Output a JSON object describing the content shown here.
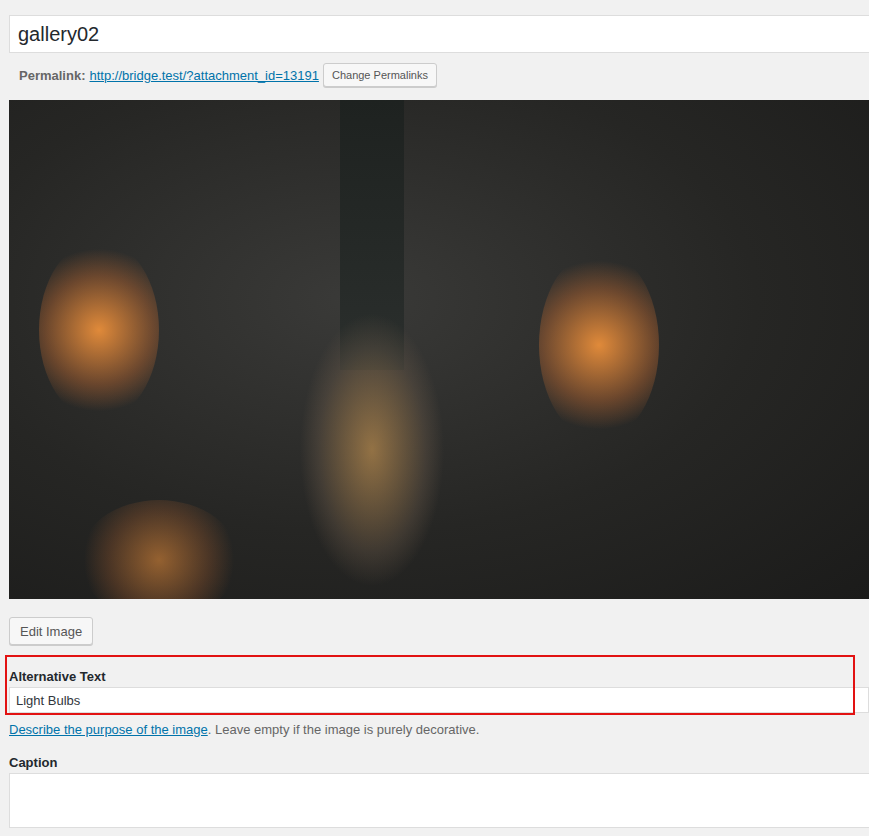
{
  "title_field": {
    "value": "gallery02"
  },
  "permalink": {
    "label": "Permalink:",
    "url": "http://bridge.test/?attachment_id=13191",
    "button": "Change Permalinks"
  },
  "edit_image_button": "Edit Image",
  "alt_text": {
    "label": "Alternative Text",
    "value": "Light Bulbs",
    "highlighted": true,
    "help_link": "Describe the purpose of the image",
    "help_text": ". Leave empty if the image is purely decorative."
  },
  "caption": {
    "label": "Caption",
    "value": ""
  }
}
